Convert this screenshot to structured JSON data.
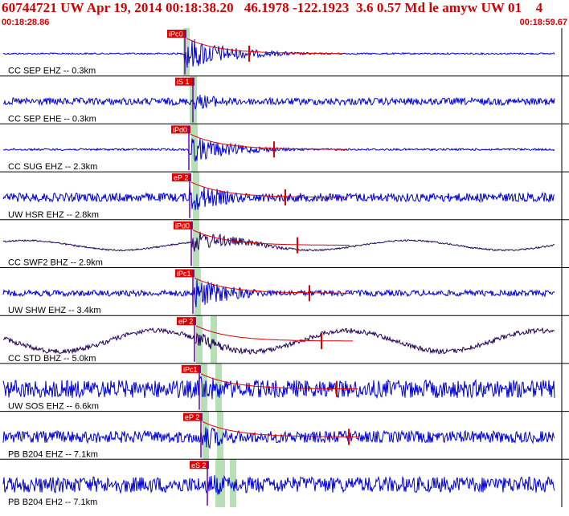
{
  "header": {
    "title": "60744721 UW Apr 19, 2014 00:18:38.20   46.1978 -122.1923  3.6 0.57 Md le amyw UW 01    4",
    "time_start": "00:18:28.86",
    "time_end": "00:18:59.67"
  },
  "colors": {
    "trace": "#0000d8",
    "trace_dark": "#20005a",
    "pick": "#e00000",
    "shade": "#a9d9a9",
    "frame": "#000000"
  },
  "traces": [
    {
      "label": "CC SEP EHZ -- 0.3km",
      "pick": "iPc0",
      "color": "trace",
      "energy": 0.95,
      "drift": 0.0,
      "noise": 0.04,
      "coda_mark": true
    },
    {
      "label": "CC SEP EHE -- 0.3km",
      "pick": "iS 1",
      "color": "trace",
      "energy": 0.45,
      "drift": 0.0,
      "noise": 0.18,
      "coda_mark": false
    },
    {
      "label": "CC SUG EHZ -- 2.3km",
      "pick": "iPd0",
      "color": "trace",
      "energy": 0.75,
      "drift": 0.0,
      "noise": 0.05,
      "coda_mark": true
    },
    {
      "label": "UW HSR EHZ -- 2.8km",
      "pick": "eP 2",
      "color": "trace",
      "energy": 0.8,
      "drift": 0.0,
      "noise": 0.22,
      "coda_mark": true
    },
    {
      "label": "CC SWF2 BHZ -- 2.9km",
      "pick": "iPd0",
      "color": "trace_dark",
      "energy": 0.6,
      "drift": 0.35,
      "noise": 0.04,
      "coda_mark": true
    },
    {
      "label": "UW SHW EHZ -- 3.4km",
      "pick": "iPc1",
      "color": "trace",
      "energy": 0.85,
      "drift": 0.0,
      "noise": 0.15,
      "coda_mark": true
    },
    {
      "label": "CC STD BHZ -- 5.0km",
      "pick": "eP 2",
      "color": "trace_dark",
      "energy": 0.45,
      "drift": 0.75,
      "noise": 0.12,
      "coda_mark": true
    },
    {
      "label": "UW SOS EHZ -- 6.6km",
      "pick": "iPc1",
      "color": "trace",
      "energy": 0.8,
      "drift": 0.0,
      "noise": 0.45,
      "coda_mark": true
    },
    {
      "label": "PB B204 EHZ -- 7.1km",
      "pick": "eP 2",
      "color": "trace",
      "energy": 0.7,
      "drift": 0.0,
      "noise": 0.3,
      "coda_mark": true
    },
    {
      "label": "PB B204 EH2 -- 7.1km",
      "pick": "eS 2",
      "color": "trace",
      "energy": 0.65,
      "drift": 0.0,
      "noise": 0.4,
      "coda_mark": false
    }
  ]
}
